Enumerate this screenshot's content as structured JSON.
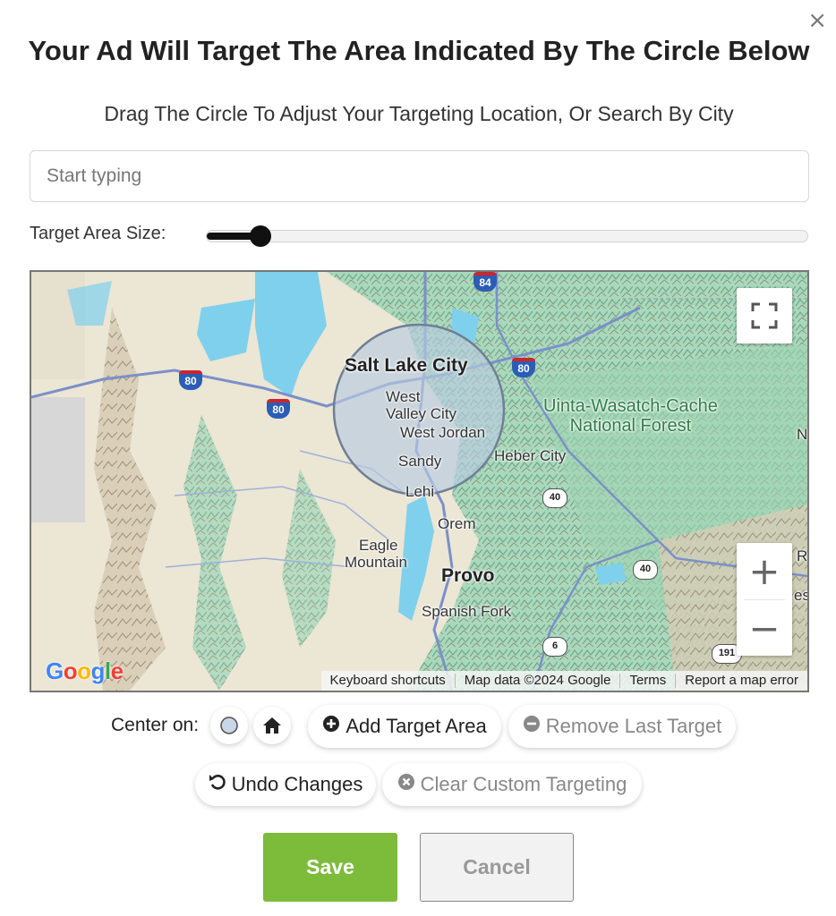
{
  "modal": {
    "close_icon": "×",
    "title": "Your Ad Will Target The Area Indicated By The Circle Below",
    "subtitle": "Drag The Circle To Adjust Your Targeting Location, Or Search By City"
  },
  "search": {
    "placeholder": "Start typing",
    "value": ""
  },
  "target_size": {
    "label": "Target Area Size:",
    "level": 0.09
  },
  "map": {
    "labels": {
      "salt_lake_city": "Salt Lake City",
      "west_valley_city_1": "West",
      "west_valley_city_2": "Valley City",
      "west_jordan": "West Jordan",
      "sandy": "Sandy",
      "lehi": "Lehi",
      "orem": "Orem",
      "eagle_mountain_1": "Eagle",
      "eagle_mountain_2": "Mountain",
      "provo": "Provo",
      "spanish_fork": "Spanish Fork",
      "heber_city": "Heber City",
      "forest_1": "Uinta-Wasatch-Cache",
      "forest_2": "National Forest",
      "edge_n": "N",
      "edge_r": "R",
      "edge_es": "es"
    },
    "shields": {
      "i80_a": "80",
      "i80_b": "80",
      "i80_c": "80",
      "i84": "84",
      "us40_a": "40",
      "us40_b": "40",
      "us6": "6",
      "us191": "191"
    },
    "fullscreen_icon": "fullscreen-icon",
    "zoom_in": "+",
    "zoom_out": "−",
    "google_logo": "Google",
    "attribution": {
      "keyboard": "Keyboard shortcuts",
      "map_data": "Map data ©2024 Google",
      "terms": "Terms",
      "report": "Report a map error"
    },
    "colors": {
      "water": "#7fd0ec",
      "forest": "#9fd3b0",
      "desert": "#e9e2cf",
      "circle": "#b9cbe0"
    }
  },
  "actions": {
    "center_on_label": "Center on:",
    "add_target": "Add Target Area",
    "remove_last": "Remove Last Target",
    "undo": "Undo Changes",
    "clear_custom": "Clear Custom Targeting"
  },
  "footer": {
    "save": "Save",
    "cancel": "Cancel"
  },
  "colors": {
    "save_green": "#7dbb3b",
    "cancel_gray": "#f2f2f2",
    "text_dark": "#222222"
  }
}
